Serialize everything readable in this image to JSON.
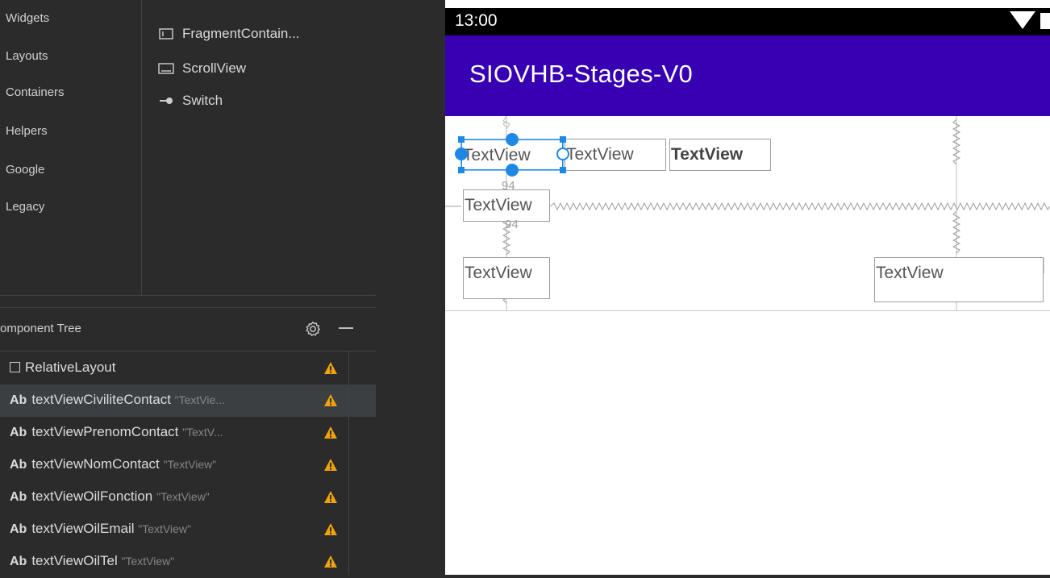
{
  "palette": {
    "categories": [
      "Widgets",
      "Layouts",
      "Containers",
      "Helpers",
      "Google",
      "Legacy"
    ],
    "items": [
      {
        "icon": "fragment-container-icon",
        "label": "FragmentContain..."
      },
      {
        "icon": "scrollview-icon",
        "label": "ScrollView"
      },
      {
        "icon": "switch-icon",
        "label": "Switch"
      }
    ]
  },
  "component_tree": {
    "title": "omponent Tree",
    "root": {
      "label": "RelativeLayout",
      "warning": true
    },
    "rows": [
      {
        "prefix": "Ab",
        "id": "textViewCiviliteContact",
        "text": "\"TextVie...",
        "selected": true
      },
      {
        "prefix": "Ab",
        "id": "textViewPrenomContact",
        "text": "\"TextV...",
        "selected": false
      },
      {
        "prefix": "Ab",
        "id": "textViewNomContact",
        "text": "\"TextView\"",
        "selected": false
      },
      {
        "prefix": "Ab",
        "id": "textViewOilFonction",
        "text": "\"TextView\"",
        "selected": false
      },
      {
        "prefix": "Ab",
        "id": "textViewOilEmail",
        "text": "\"TextView\"",
        "selected": false
      },
      {
        "prefix": "Ab",
        "id": "textViewOilTel",
        "text": "\"TextView\"",
        "selected": false
      }
    ]
  },
  "device": {
    "status_time": "13:00",
    "app_title": "SIOVHB-Stages-V0",
    "textviews": {
      "tv1": "TextView",
      "tv2": "TextView",
      "tv3": "TextView",
      "tv4": "TextView",
      "tv5": "TextView",
      "tv6": "TextView"
    },
    "dimension_labels": {
      "margin_top": "94",
      "margin_bottom": "94"
    }
  },
  "colors": {
    "app_bar": "#3700b3",
    "selection": "#1e88e5",
    "warning": "#f0a30a",
    "ide_background": "#2b2b2b"
  }
}
